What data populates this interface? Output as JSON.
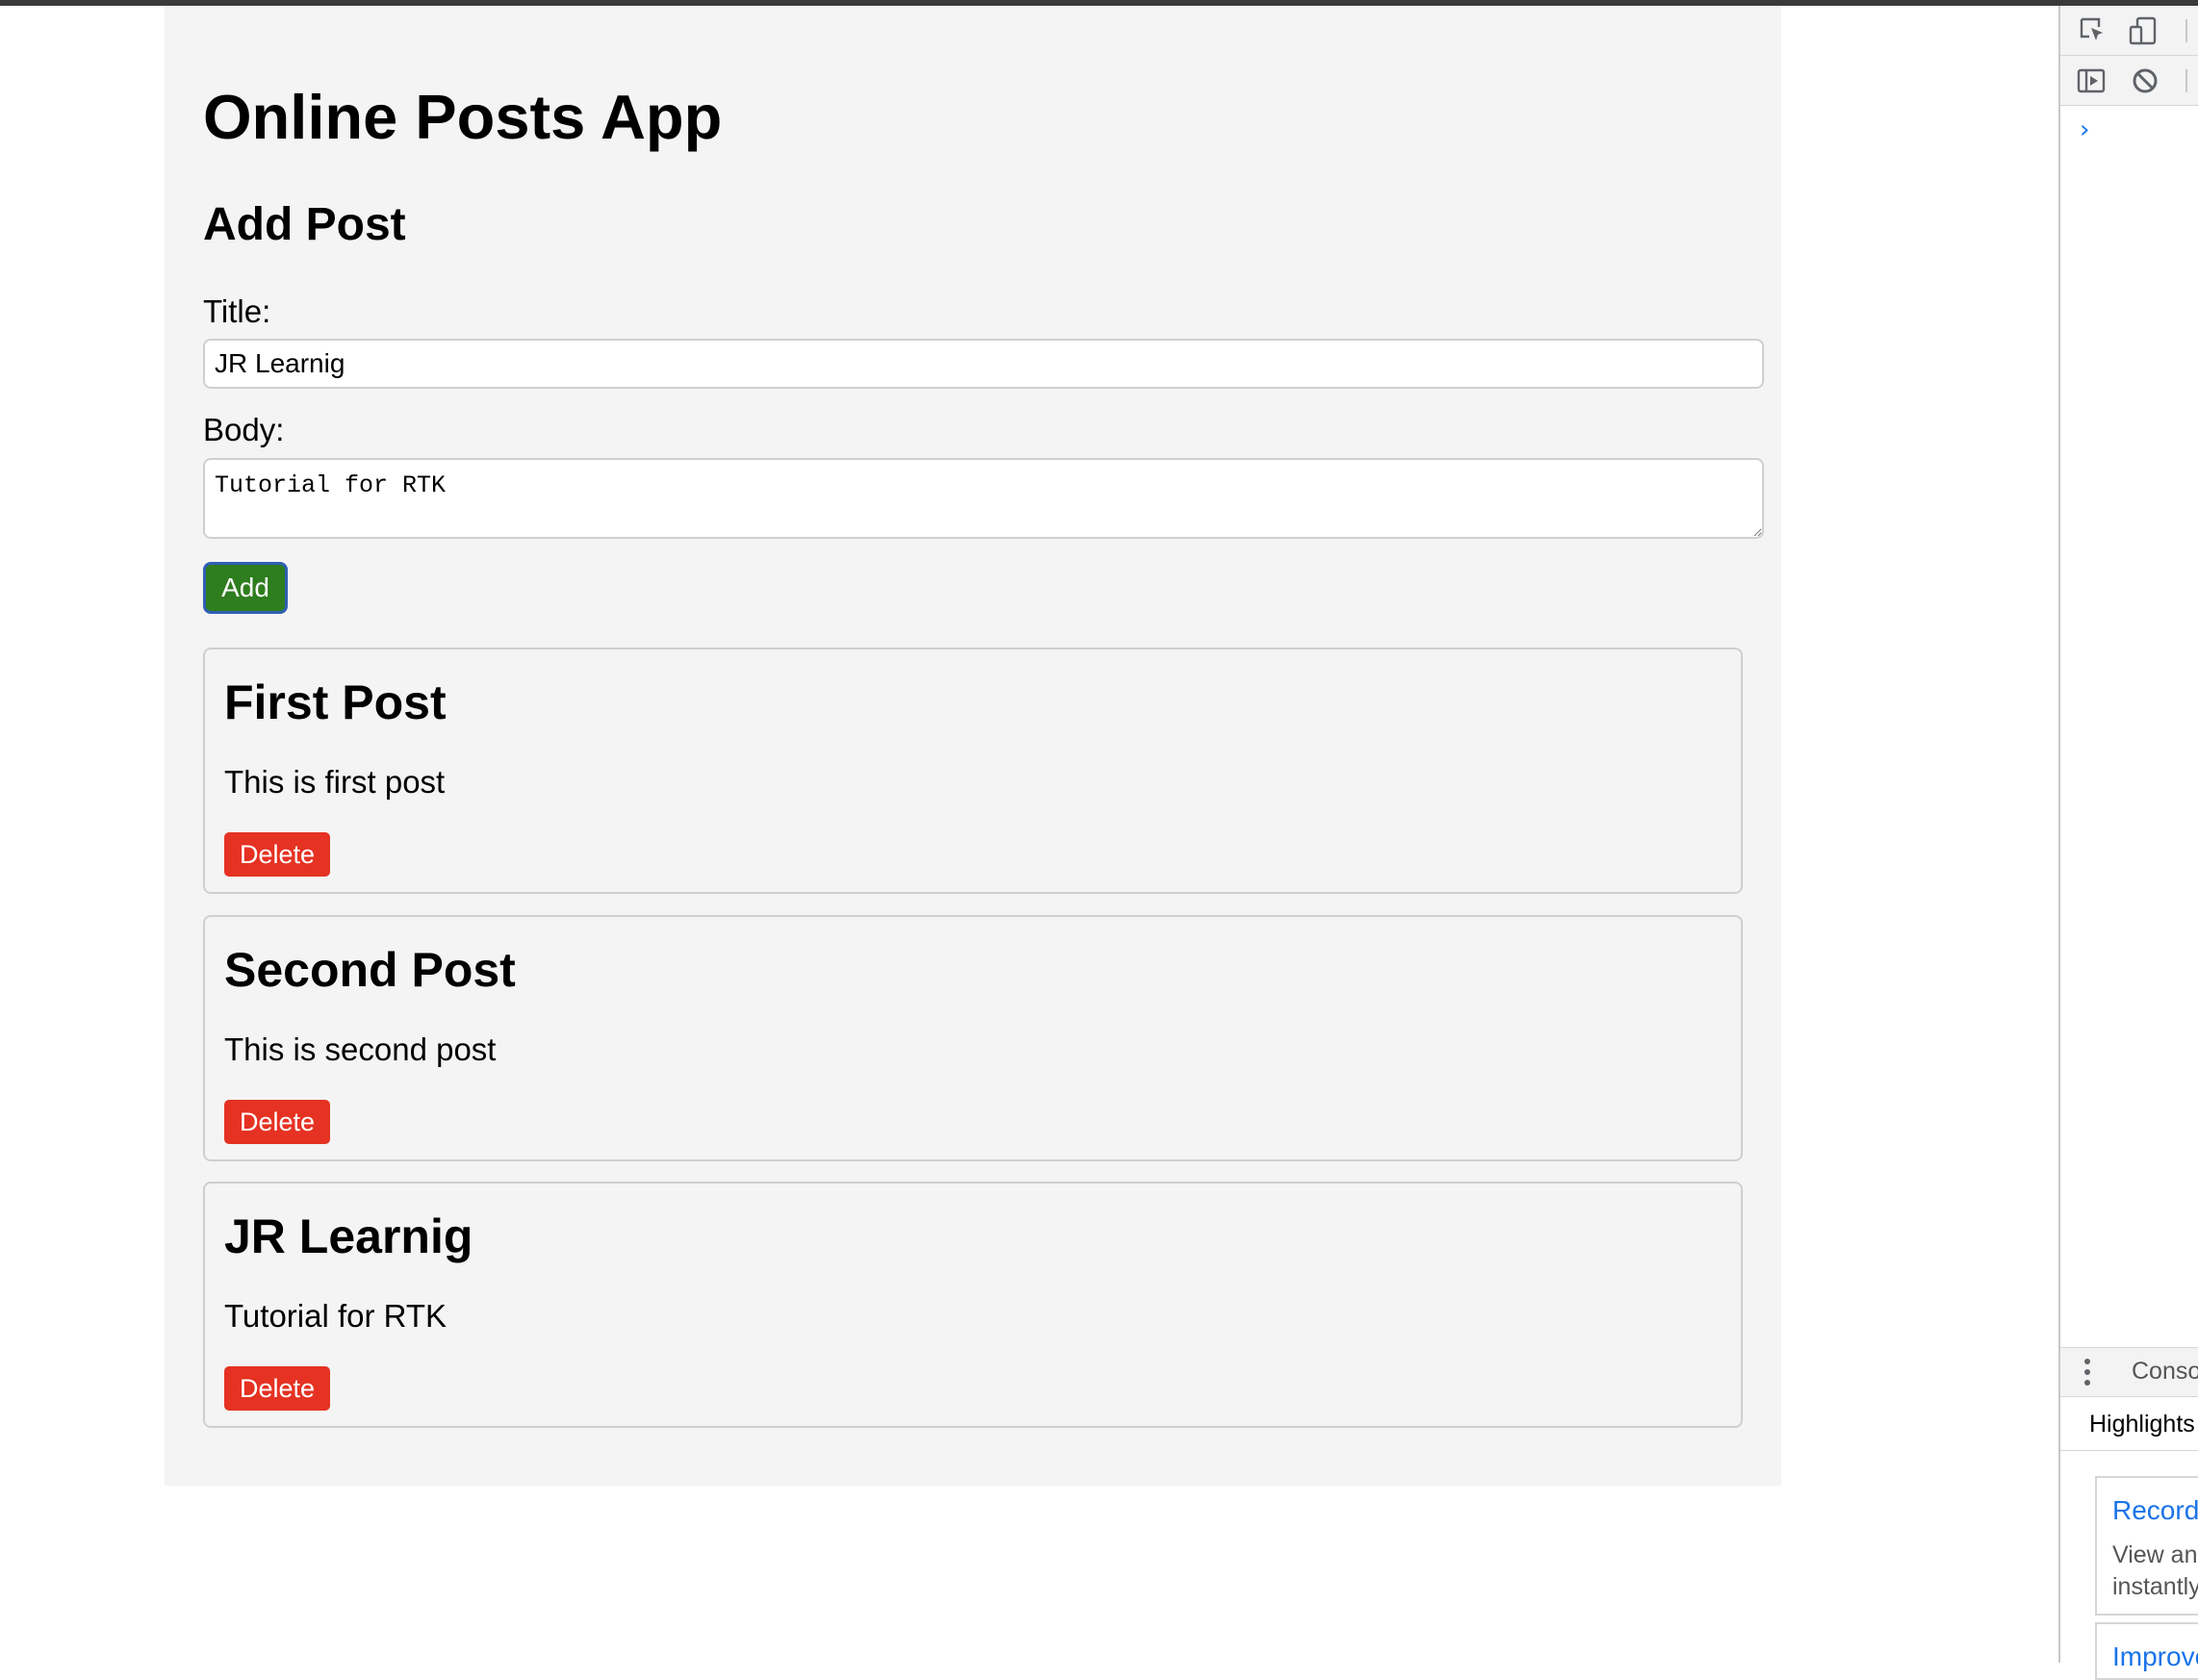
{
  "app": {
    "title": "Online Posts App",
    "form_heading": "Add Post",
    "title_label": "Title:",
    "title_value": "JR Learnig",
    "body_label": "Body:",
    "body_value": "Tutorial for RTK",
    "add_label": "Add"
  },
  "posts": [
    {
      "title": "First Post",
      "body": "This is first post",
      "delete_label": "Delete"
    },
    {
      "title": "Second Post",
      "body": "This is second post",
      "delete_label": "Delete"
    },
    {
      "title": "JR Learnig",
      "body": "Tutorial for RTK",
      "delete_label": "Delete"
    }
  ],
  "devtools": {
    "prompt": "›",
    "console_tab": "Conso",
    "highlights_tab": "Highlights",
    "card1_title": "Record",
    "card1_line1": "View an",
    "card1_line2": "instantly",
    "card2_title": "Improve",
    "icons": [
      "inspect-element-icon",
      "device-toggle-icon",
      "sidebar-toggle-icon",
      "clear-console-icon",
      "kebab-menu-icon"
    ]
  },
  "colors": {
    "app_background": "#f4f4f4",
    "add_button": "#2e7d1e",
    "add_button_focus_ring": "#2f5fb3",
    "delete_button": "#e53222",
    "link_blue": "#1a73e8"
  }
}
